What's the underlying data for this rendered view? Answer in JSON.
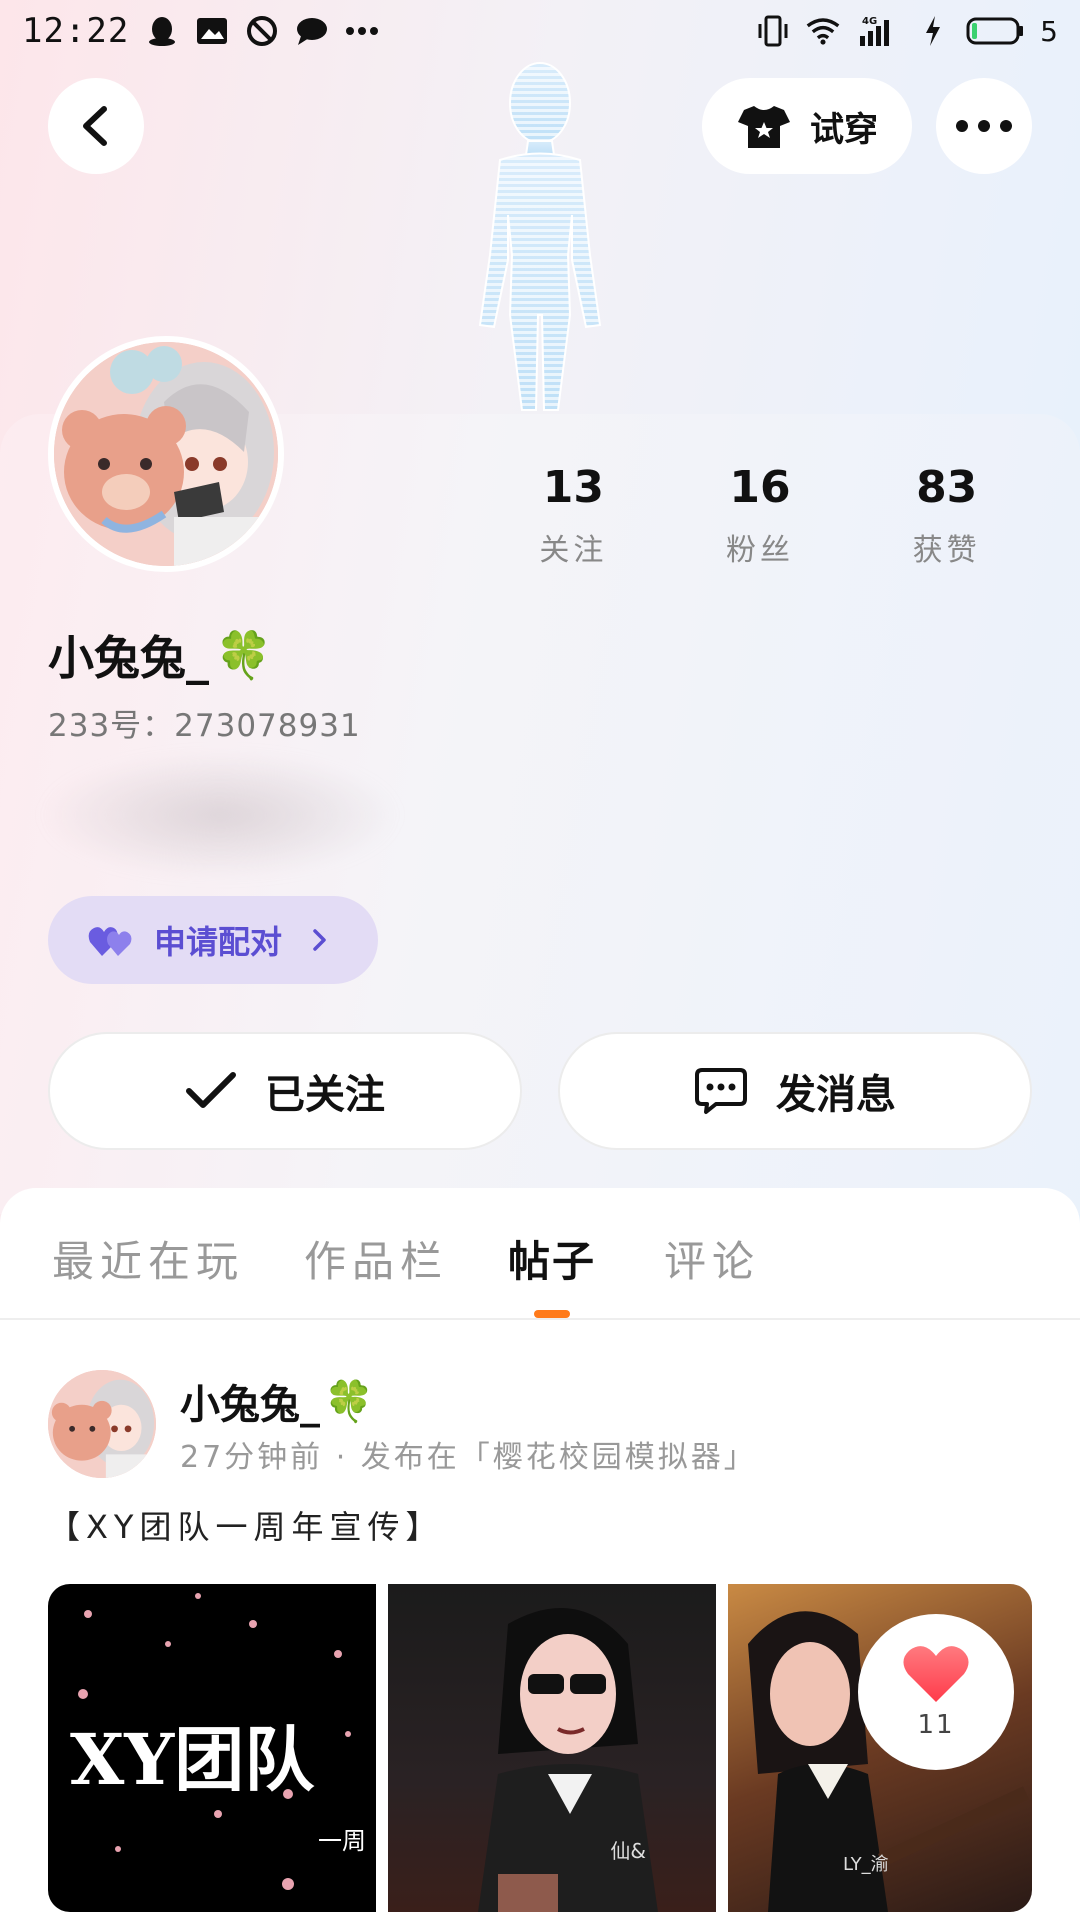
{
  "status_bar": {
    "time": "12:22",
    "network": "4G",
    "battery": "5"
  },
  "top_bar": {
    "tryon_label": "试穿"
  },
  "profile": {
    "nickname": "小兔兔_",
    "nickname_emoji": "🍀",
    "uid": "233号：273078931",
    "stats": [
      {
        "value": "13",
        "label": "关注"
      },
      {
        "value": "16",
        "label": "粉丝"
      },
      {
        "value": "83",
        "label": "获赞"
      }
    ],
    "pair_label": "申请配对",
    "follow_label": "已关注",
    "message_label": "发消息"
  },
  "tabs": [
    "最近在玩",
    "作品栏",
    "帖子",
    "评论"
  ],
  "active_tab": "帖子",
  "post": {
    "author": "小兔兔_",
    "author_emoji": "🍀",
    "meta": "27分钟前 · 发布在「樱花校园模拟器」",
    "text": "【XY团队一周年宣传】",
    "images": [
      {
        "title": "XY团队",
        "subtitle": "一周"
      },
      {
        "signature": "仙&"
      },
      {
        "signature": "LY_渝"
      }
    ],
    "like_count": "11"
  },
  "colors": {
    "accent": "#ff7a1a",
    "pair_text": "#5b4ed2",
    "pair_bg": "#e3dcf5",
    "like_heart": "#ff4d5a"
  }
}
